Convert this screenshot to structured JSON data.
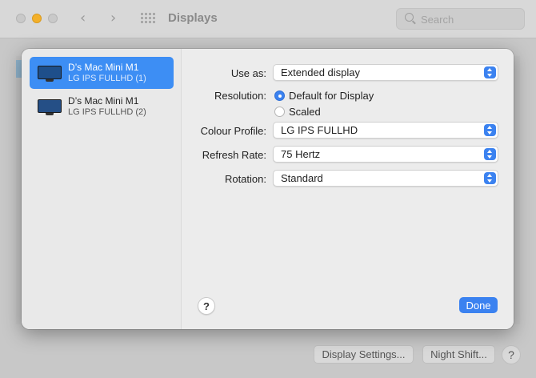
{
  "window": {
    "title": "Displays",
    "search_placeholder": "Search",
    "buttons": {
      "display_settings": "Display Settings...",
      "night_shift": "Night Shift...",
      "help": "?"
    }
  },
  "sheet": {
    "displays": [
      {
        "name": "D’s Mac Mini M1",
        "subtitle": "LG IPS FULLHD (1)",
        "selected": true
      },
      {
        "name": "D’s Mac Mini M1",
        "subtitle": "LG IPS FULLHD (2)",
        "selected": false
      }
    ],
    "settings": {
      "use_as": {
        "label": "Use as:",
        "value": "Extended display"
      },
      "resolution": {
        "label": "Resolution:",
        "options": [
          "Default for Display",
          "Scaled"
        ],
        "selected": "Default for Display"
      },
      "colour_profile": {
        "label": "Colour Profile:",
        "value": "LG IPS FULLHD"
      },
      "refresh_rate": {
        "label": "Refresh Rate:",
        "value": "75 Hertz"
      },
      "rotation": {
        "label": "Rotation:",
        "value": "Standard"
      }
    },
    "help_label": "?",
    "done_label": "Done"
  },
  "colors": {
    "accent": "#3b82f0",
    "selection": "#3d8ef4"
  }
}
